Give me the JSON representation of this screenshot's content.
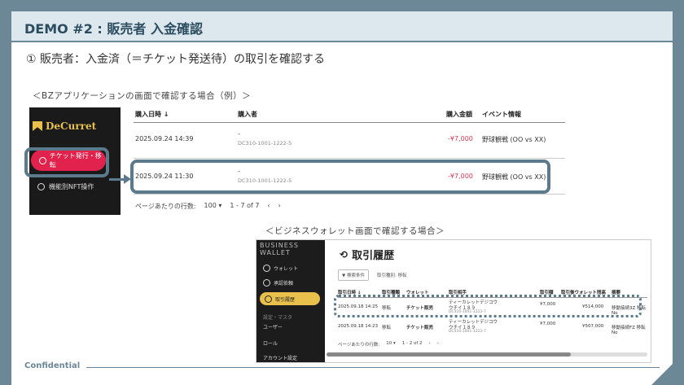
{
  "slide": {
    "title": "DEMO #2 : 販売者 入金確認",
    "subtitle": "① 販売者：入金済（＝チケット発送待）の取引を確認する",
    "note_bz": "＜BZアプリケーションの画面で確認する場合（例）＞",
    "note_wallet": "＜ビジネスウォレット画面で確認する場合＞",
    "footer": "Confidential",
    "colors": {
      "frame": "#6c8795",
      "accent_red": "#e0224c",
      "accent_gold": "#e9c04b"
    }
  },
  "bz_app": {
    "logo": "DeCurret",
    "sidebar": [
      {
        "label": "チケット発行・移転",
        "icon": "ticket-icon",
        "active": true
      },
      {
        "label": "機能別NFT操作",
        "icon": "nft-icon",
        "active": false
      }
    ],
    "table": {
      "headers": {
        "date": "購入日時 ↓",
        "buyer": "購入者",
        "amount": "購入金額",
        "event": "イベント情報"
      },
      "rows": [
        {
          "date": "2025.09.24 14:39",
          "buyer": "-",
          "buyer_id": "DC310-1001-1222-5",
          "amount": "-¥7,000",
          "event": "野球観戦 (OO vs XX)"
        },
        {
          "date": "2025.09.24 11:30",
          "buyer": "-",
          "buyer_id": "DC310-1001-1222-5",
          "amount": "-¥7,000",
          "event": "野球観戦 (OO vs XX)"
        }
      ]
    },
    "pager": {
      "rows_label": "ページあたりの行数:",
      "rows_value": "100 ▾",
      "range": "1 - 7 of 7",
      "prev": "‹",
      "next": "›"
    }
  },
  "business_wallet": {
    "brand": "BUSINESS WALLET",
    "sidebar": [
      {
        "label": "ウォレット"
      },
      {
        "label": "承認依頼"
      },
      {
        "label": "取引履歴",
        "active": true
      },
      {
        "label": "設定・マスタ"
      },
      {
        "label": "ユーザー"
      },
      {
        "label": "ロール"
      },
      {
        "label": "アカウント設定"
      }
    ],
    "title": "取引履歴",
    "filter": {
      "button": "▼ 検索条件",
      "hint": "取引種別: 移転"
    },
    "headers": {
      "date": "取引日時 ↓",
      "type": "取引種類",
      "wallet": "ウォレット",
      "party": "取引相手",
      "amount": "取引額",
      "balance": "取引後ウォレット残高",
      "summary": "摘要"
    },
    "rows": [
      {
        "date": "2025.09.18 14:25",
        "type": "移転",
        "wallet": "チケット販売",
        "party": "ティーカレットデジコウ",
        "party2": "ウチイ１８９",
        "party_id": "DC310-1001-1222-7",
        "amount": "¥7,000",
        "balance": "¥514,000",
        "summary": "移動接続3Z 移転No"
      },
      {
        "date": "2025.09.18 14:23",
        "type": "移転",
        "wallet": "チケット販売",
        "party": "ティーカレットデジコウ",
        "party2": "ウチイ１８９",
        "party_id": "DC310-1001-1222-7",
        "amount": "¥7,000",
        "balance": "¥507,000",
        "summary": "移動接続FZ 移転No"
      }
    ],
    "pager": {
      "rows_label": "ページあたりの行数:",
      "rows_value": "10 ▾",
      "range": "1 - 2 of 2",
      "prev": "‹",
      "next": "›"
    }
  }
}
